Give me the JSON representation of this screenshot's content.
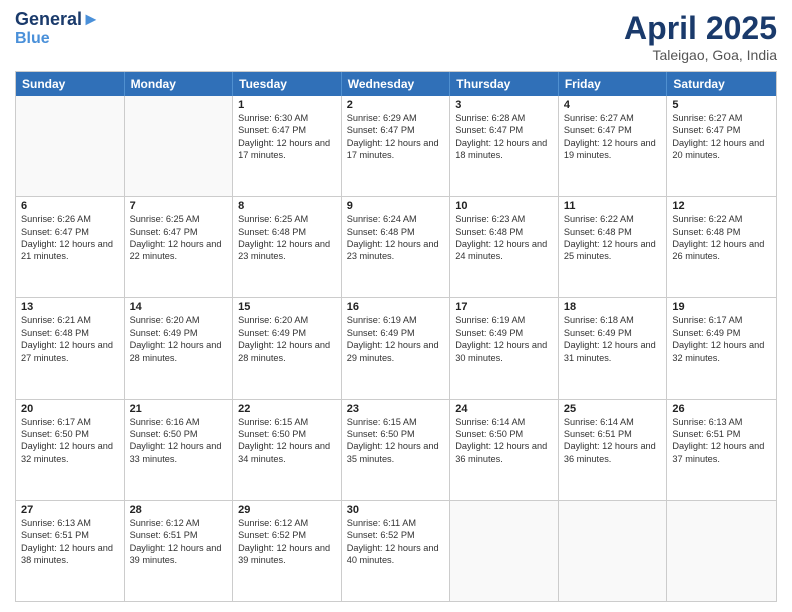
{
  "header": {
    "logo_line1": "General",
    "logo_line2": "Blue",
    "title": "April 2025",
    "subtitle": "Taleigao, Goa, India"
  },
  "days_of_week": [
    "Sunday",
    "Monday",
    "Tuesday",
    "Wednesday",
    "Thursday",
    "Friday",
    "Saturday"
  ],
  "weeks": [
    [
      {
        "day": "",
        "sunrise": "",
        "sunset": "",
        "daylight": "",
        "empty": true
      },
      {
        "day": "",
        "sunrise": "",
        "sunset": "",
        "daylight": "",
        "empty": true
      },
      {
        "day": "1",
        "sunrise": "Sunrise: 6:30 AM",
        "sunset": "Sunset: 6:47 PM",
        "daylight": "Daylight: 12 hours and 17 minutes."
      },
      {
        "day": "2",
        "sunrise": "Sunrise: 6:29 AM",
        "sunset": "Sunset: 6:47 PM",
        "daylight": "Daylight: 12 hours and 17 minutes."
      },
      {
        "day": "3",
        "sunrise": "Sunrise: 6:28 AM",
        "sunset": "Sunset: 6:47 PM",
        "daylight": "Daylight: 12 hours and 18 minutes."
      },
      {
        "day": "4",
        "sunrise": "Sunrise: 6:27 AM",
        "sunset": "Sunset: 6:47 PM",
        "daylight": "Daylight: 12 hours and 19 minutes."
      },
      {
        "day": "5",
        "sunrise": "Sunrise: 6:27 AM",
        "sunset": "Sunset: 6:47 PM",
        "daylight": "Daylight: 12 hours and 20 minutes."
      }
    ],
    [
      {
        "day": "6",
        "sunrise": "Sunrise: 6:26 AM",
        "sunset": "Sunset: 6:47 PM",
        "daylight": "Daylight: 12 hours and 21 minutes."
      },
      {
        "day": "7",
        "sunrise": "Sunrise: 6:25 AM",
        "sunset": "Sunset: 6:47 PM",
        "daylight": "Daylight: 12 hours and 22 minutes."
      },
      {
        "day": "8",
        "sunrise": "Sunrise: 6:25 AM",
        "sunset": "Sunset: 6:48 PM",
        "daylight": "Daylight: 12 hours and 23 minutes."
      },
      {
        "day": "9",
        "sunrise": "Sunrise: 6:24 AM",
        "sunset": "Sunset: 6:48 PM",
        "daylight": "Daylight: 12 hours and 23 minutes."
      },
      {
        "day": "10",
        "sunrise": "Sunrise: 6:23 AM",
        "sunset": "Sunset: 6:48 PM",
        "daylight": "Daylight: 12 hours and 24 minutes."
      },
      {
        "day": "11",
        "sunrise": "Sunrise: 6:22 AM",
        "sunset": "Sunset: 6:48 PM",
        "daylight": "Daylight: 12 hours and 25 minutes."
      },
      {
        "day": "12",
        "sunrise": "Sunrise: 6:22 AM",
        "sunset": "Sunset: 6:48 PM",
        "daylight": "Daylight: 12 hours and 26 minutes."
      }
    ],
    [
      {
        "day": "13",
        "sunrise": "Sunrise: 6:21 AM",
        "sunset": "Sunset: 6:48 PM",
        "daylight": "Daylight: 12 hours and 27 minutes."
      },
      {
        "day": "14",
        "sunrise": "Sunrise: 6:20 AM",
        "sunset": "Sunset: 6:49 PM",
        "daylight": "Daylight: 12 hours and 28 minutes."
      },
      {
        "day": "15",
        "sunrise": "Sunrise: 6:20 AM",
        "sunset": "Sunset: 6:49 PM",
        "daylight": "Daylight: 12 hours and 28 minutes."
      },
      {
        "day": "16",
        "sunrise": "Sunrise: 6:19 AM",
        "sunset": "Sunset: 6:49 PM",
        "daylight": "Daylight: 12 hours and 29 minutes."
      },
      {
        "day": "17",
        "sunrise": "Sunrise: 6:19 AM",
        "sunset": "Sunset: 6:49 PM",
        "daylight": "Daylight: 12 hours and 30 minutes."
      },
      {
        "day": "18",
        "sunrise": "Sunrise: 6:18 AM",
        "sunset": "Sunset: 6:49 PM",
        "daylight": "Daylight: 12 hours and 31 minutes."
      },
      {
        "day": "19",
        "sunrise": "Sunrise: 6:17 AM",
        "sunset": "Sunset: 6:49 PM",
        "daylight": "Daylight: 12 hours and 32 minutes."
      }
    ],
    [
      {
        "day": "20",
        "sunrise": "Sunrise: 6:17 AM",
        "sunset": "Sunset: 6:50 PM",
        "daylight": "Daylight: 12 hours and 32 minutes."
      },
      {
        "day": "21",
        "sunrise": "Sunrise: 6:16 AM",
        "sunset": "Sunset: 6:50 PM",
        "daylight": "Daylight: 12 hours and 33 minutes."
      },
      {
        "day": "22",
        "sunrise": "Sunrise: 6:15 AM",
        "sunset": "Sunset: 6:50 PM",
        "daylight": "Daylight: 12 hours and 34 minutes."
      },
      {
        "day": "23",
        "sunrise": "Sunrise: 6:15 AM",
        "sunset": "Sunset: 6:50 PM",
        "daylight": "Daylight: 12 hours and 35 minutes."
      },
      {
        "day": "24",
        "sunrise": "Sunrise: 6:14 AM",
        "sunset": "Sunset: 6:50 PM",
        "daylight": "Daylight: 12 hours and 36 minutes."
      },
      {
        "day": "25",
        "sunrise": "Sunrise: 6:14 AM",
        "sunset": "Sunset: 6:51 PM",
        "daylight": "Daylight: 12 hours and 36 minutes."
      },
      {
        "day": "26",
        "sunrise": "Sunrise: 6:13 AM",
        "sunset": "Sunset: 6:51 PM",
        "daylight": "Daylight: 12 hours and 37 minutes."
      }
    ],
    [
      {
        "day": "27",
        "sunrise": "Sunrise: 6:13 AM",
        "sunset": "Sunset: 6:51 PM",
        "daylight": "Daylight: 12 hours and 38 minutes."
      },
      {
        "day": "28",
        "sunrise": "Sunrise: 6:12 AM",
        "sunset": "Sunset: 6:51 PM",
        "daylight": "Daylight: 12 hours and 39 minutes."
      },
      {
        "day": "29",
        "sunrise": "Sunrise: 6:12 AM",
        "sunset": "Sunset: 6:52 PM",
        "daylight": "Daylight: 12 hours and 39 minutes."
      },
      {
        "day": "30",
        "sunrise": "Sunrise: 6:11 AM",
        "sunset": "Sunset: 6:52 PM",
        "daylight": "Daylight: 12 hours and 40 minutes."
      },
      {
        "day": "",
        "sunrise": "",
        "sunset": "",
        "daylight": "",
        "empty": true
      },
      {
        "day": "",
        "sunrise": "",
        "sunset": "",
        "daylight": "",
        "empty": true
      },
      {
        "day": "",
        "sunrise": "",
        "sunset": "",
        "daylight": "",
        "empty": true
      }
    ]
  ]
}
